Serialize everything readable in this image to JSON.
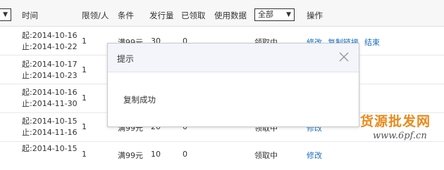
{
  "header": {
    "col_time": "时间",
    "col_limit": "限领/人",
    "col_condition": "条件",
    "col_issued": "发行量",
    "col_claimed": "已领取",
    "col_usage": "使用数据",
    "status_filter": "全部",
    "col_action": "操作"
  },
  "rows": [
    {
      "start": "起:2014-10-16",
      "end": "止:2014-10-22",
      "limit": "1",
      "condition": "满99元",
      "issued": "30",
      "claimed": "0",
      "status": "领取中",
      "actions": [
        "修改",
        "复制链接",
        "结束"
      ]
    },
    {
      "start": "起:2014-10-17",
      "end": "止:2014-10-23",
      "limit": "1",
      "condition": "",
      "issued": "",
      "claimed": "",
      "status": "",
      "actions": []
    },
    {
      "start": "起:2014-10-16",
      "end": "止:2014-11-30",
      "limit": "1",
      "condition": "",
      "issued": "",
      "claimed": "",
      "status": "",
      "actions": []
    },
    {
      "start": "起:2014-10-15",
      "end": "止:2014-11-16",
      "limit": "1",
      "condition": "满99元",
      "issued": "20",
      "claimed": "0",
      "status": "领取中",
      "actions": [
        "修改"
      ]
    },
    {
      "start": "起:2014-10-15",
      "end": "",
      "limit": "1",
      "condition": "满99元",
      "issued": "10",
      "claimed": "0",
      "status": "领取中",
      "actions": [
        "修改"
      ]
    }
  ],
  "dialog": {
    "title": "提示",
    "message": "复制成功"
  },
  "watermark": {
    "line1": "货源批发网",
    "line2": "www.6pf.cn"
  }
}
